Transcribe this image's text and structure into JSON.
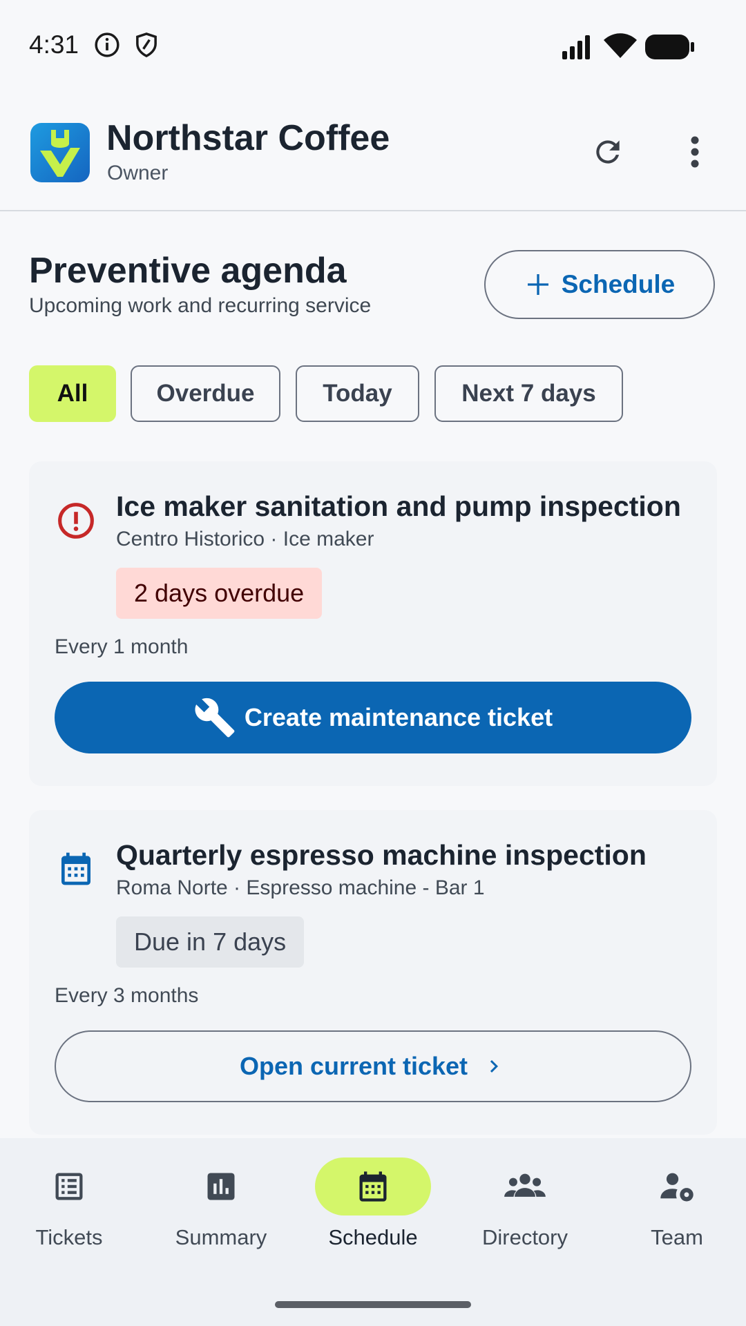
{
  "status_bar": {
    "time": "4:31"
  },
  "app": {
    "name": "Northstar Coffee",
    "role": "Owner"
  },
  "header": {
    "title": "Preventive agenda",
    "subtitle": "Upcoming work and recurring service",
    "schedule_button": "Schedule"
  },
  "filters": [
    {
      "label": "All",
      "active": true
    },
    {
      "label": "Overdue",
      "active": false
    },
    {
      "label": "Today",
      "active": false
    },
    {
      "label": "Next 7 days",
      "active": false
    }
  ],
  "cards": [
    {
      "icon": "alert-circle-icon",
      "title": "Ice maker sanitation and pump inspection",
      "subtitle": "Centro Historico · Ice maker",
      "badge": "2 days overdue",
      "frequency": "Every 1 month",
      "action": "Create maintenance ticket"
    },
    {
      "icon": "calendar-icon",
      "title": "Quarterly espresso machine inspection",
      "subtitle": "Roma Norte · Espresso machine - Bar 1",
      "badge": "Due in 7 days",
      "frequency": "Every 3 months",
      "action": "Open current ticket"
    }
  ],
  "bottom_nav": [
    {
      "label": "Tickets",
      "icon": "list-icon"
    },
    {
      "label": "Summary",
      "icon": "bar-chart-icon"
    },
    {
      "label": "Schedule",
      "icon": "calendar-icon",
      "active": true
    },
    {
      "label": "Directory",
      "icon": "people-icon"
    },
    {
      "label": "Team",
      "icon": "team-settings-icon"
    }
  ],
  "colors": {
    "accent": "#0b66b3",
    "active_chip": "#d4f66a",
    "overdue_badge_bg": "#ffd9d6",
    "overdue_icon": "#c62828",
    "neutral_badge_bg": "#e4e7eb"
  }
}
